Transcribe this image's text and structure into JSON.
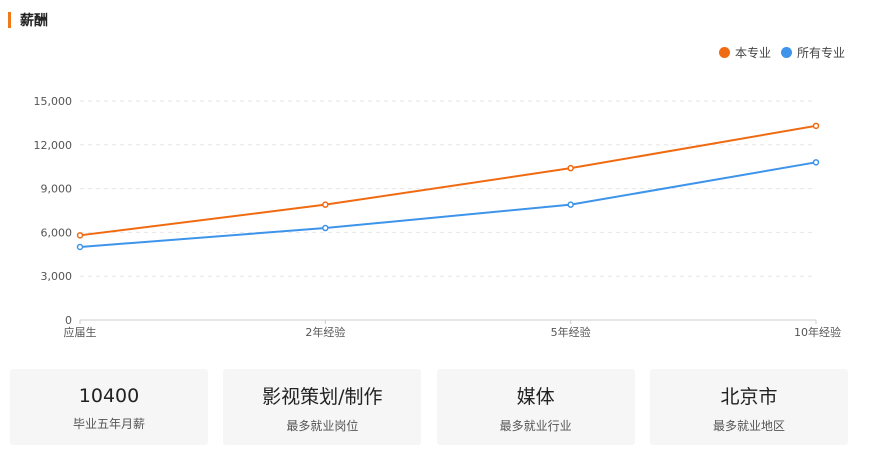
{
  "header": {
    "title": "薪酬"
  },
  "legend": [
    {
      "label": "本专业",
      "color": "#f06a12"
    },
    {
      "label": "所有专业",
      "color": "#3d94ea"
    }
  ],
  "chart_data": {
    "type": "line",
    "categories": [
      "应届生",
      "2年经验",
      "5年经验",
      "10年经验"
    ],
    "series": [
      {
        "name": "本专业",
        "color": "#f06a12",
        "values": [
          5800,
          7900,
          10400,
          13300
        ]
      },
      {
        "name": "所有专业",
        "color": "#3d94ea",
        "values": [
          5000,
          6300,
          7900,
          10800
        ]
      }
    ],
    "yticks": [
      "0",
      "3,000",
      "6,000",
      "9,000",
      "12,000",
      "15,000"
    ],
    "ytick_values": [
      0,
      3000,
      6000,
      9000,
      12000,
      15000
    ],
    "ylim": [
      0,
      15000
    ],
    "grid": true,
    "legend_position": "top-right"
  },
  "cards": [
    {
      "value": "10400",
      "label": "毕业五年月薪"
    },
    {
      "value": "影视策划/制作",
      "label": "最多就业岗位"
    },
    {
      "value": "媒体",
      "label": "最多就业行业"
    },
    {
      "value": "北京市",
      "label": "最多就业地区"
    }
  ]
}
